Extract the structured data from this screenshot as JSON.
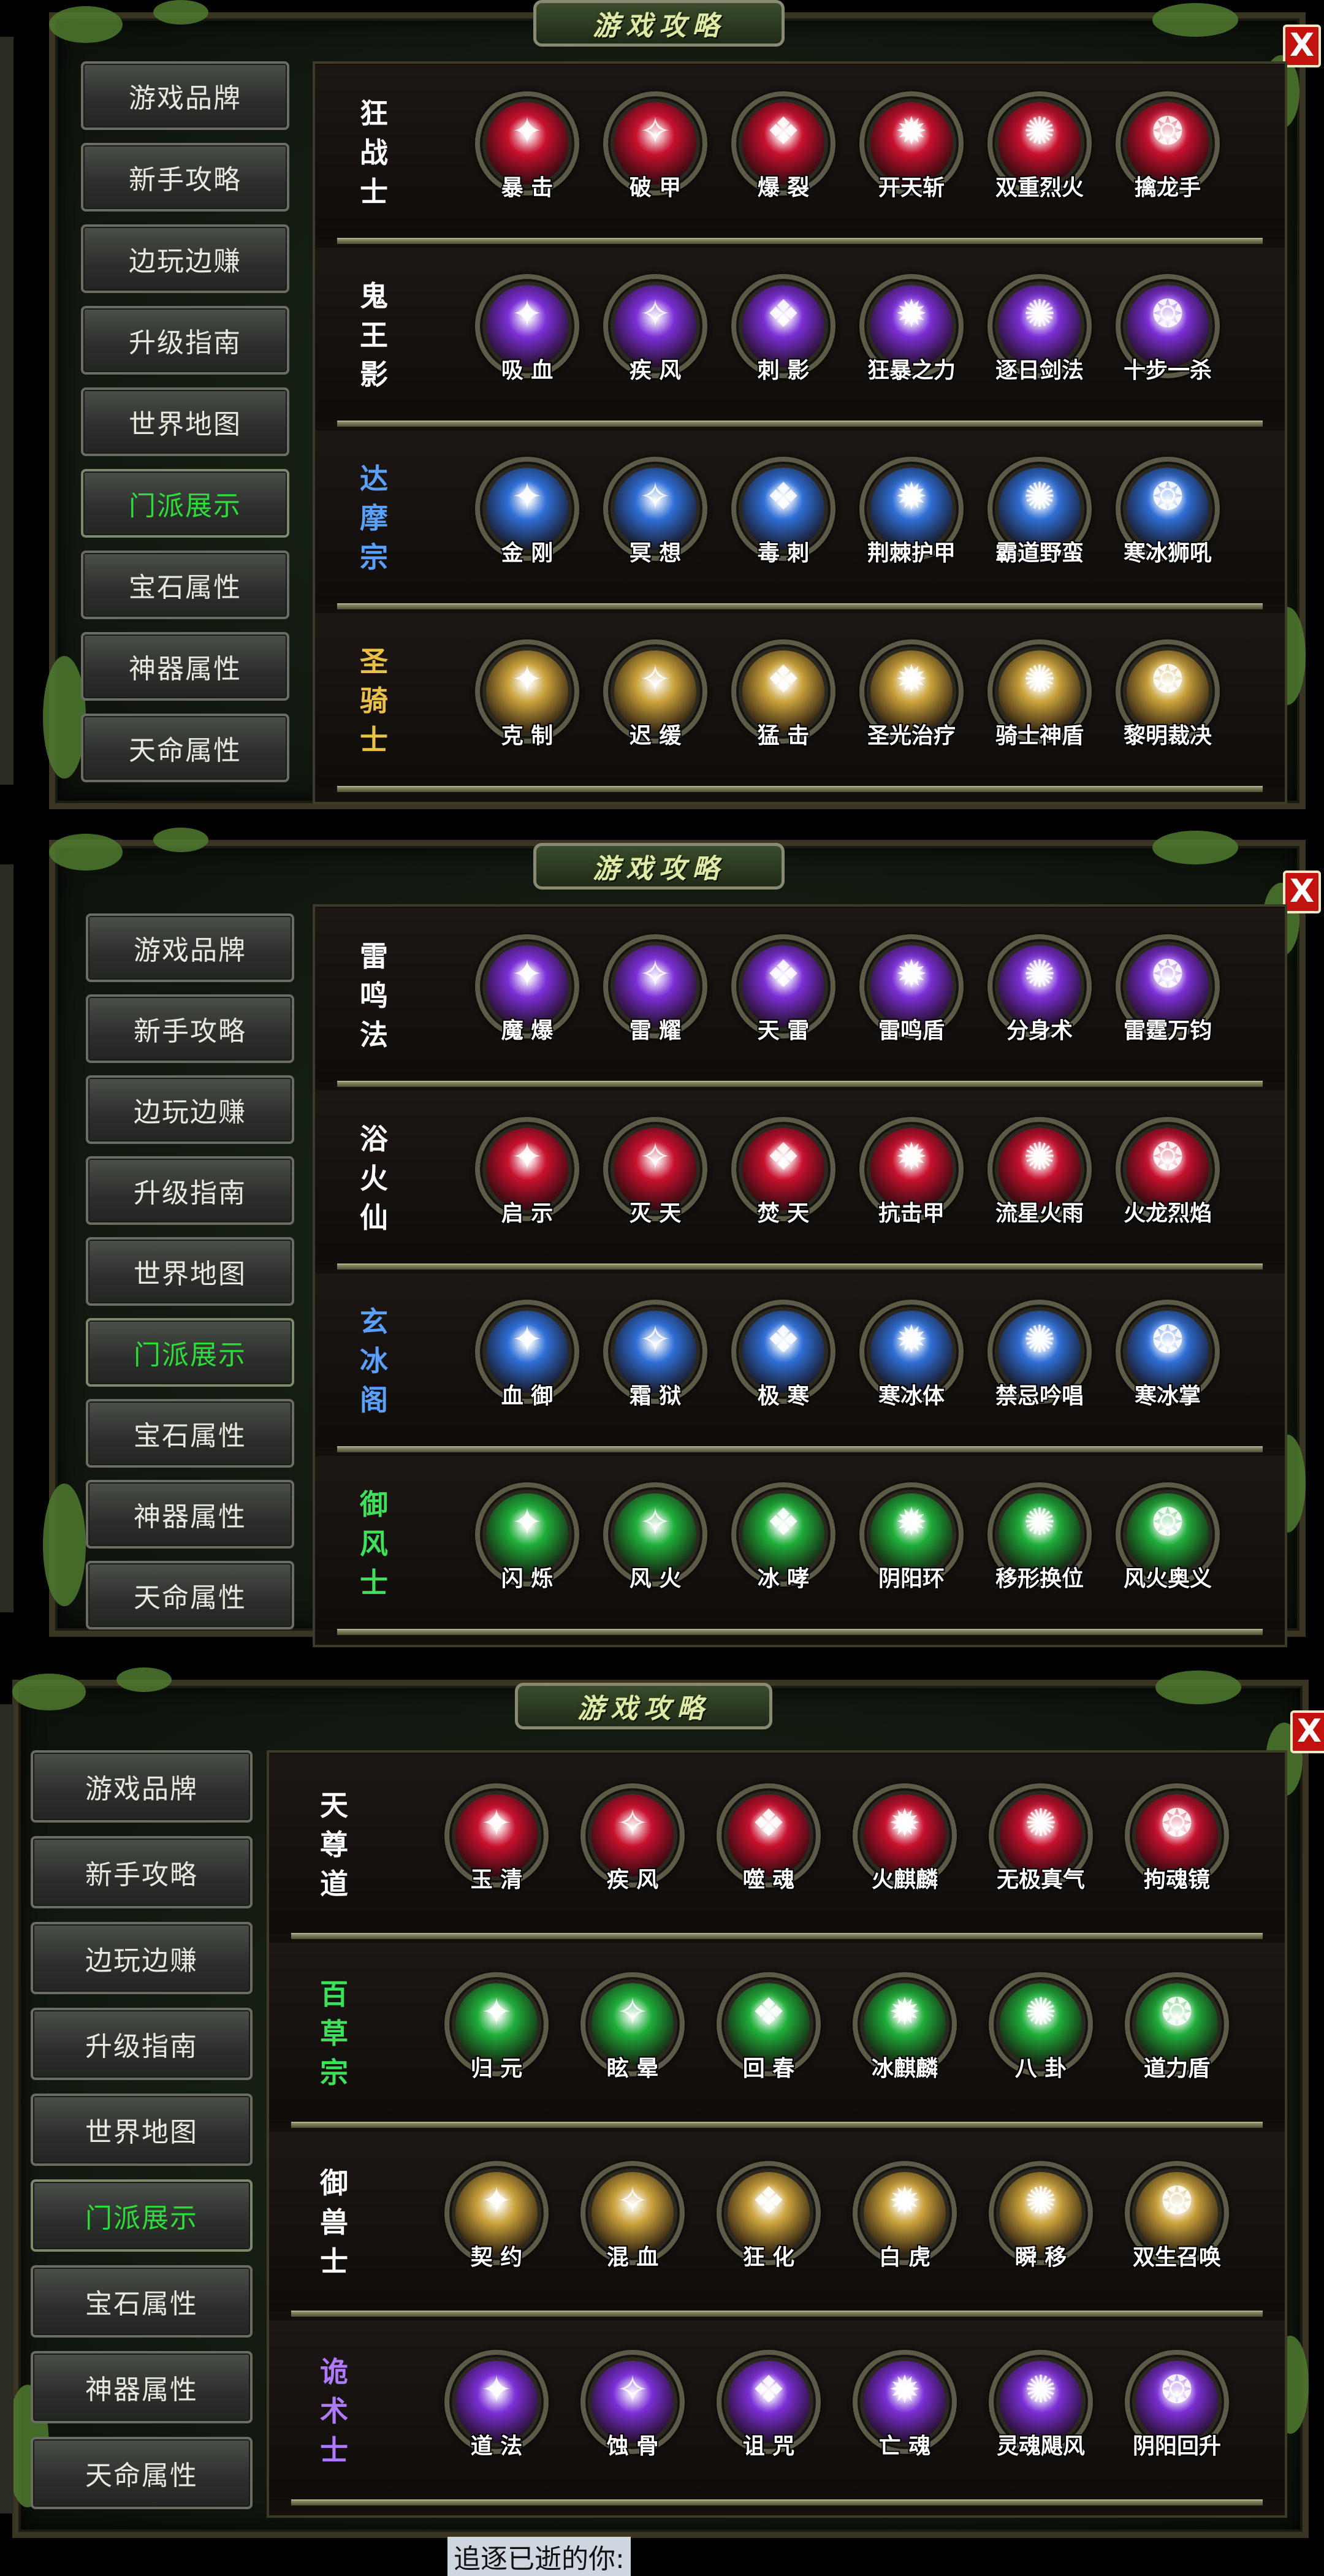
{
  "title": "游戏攻略",
  "close_label": "X",
  "nav_items": [
    "游戏品牌",
    "新手攻略",
    "边玩边赚",
    "升级指南",
    "世界地图",
    "门派展示",
    "宝石属性",
    "神器属性",
    "天命属性"
  ],
  "active_nav_index": 5,
  "panels": [
    {
      "factions": [
        {
          "name_chars": [
            "狂",
            "战",
            "士"
          ],
          "color": "#ffffff",
          "skills": [
            {
              "name": "暴 击"
            },
            {
              "name": "破 甲"
            },
            {
              "name": "爆 裂"
            },
            {
              "name": "开天斩"
            },
            {
              "name": "双重烈火"
            },
            {
              "name": "擒龙手"
            }
          ],
          "orb_color": "#c8102e"
        },
        {
          "name_chars": [
            "鬼",
            "王",
            "影"
          ],
          "color": "#ffffff",
          "skills": [
            {
              "name": "吸 血"
            },
            {
              "name": "疾 风"
            },
            {
              "name": "刺 影"
            },
            {
              "name": "狂暴之力"
            },
            {
              "name": "逐日剑法"
            },
            {
              "name": "十步一杀"
            }
          ],
          "orb_color": "#7b2fd6"
        },
        {
          "name_chars": [
            "达",
            "摩",
            "宗"
          ],
          "color": "#5aa0ff",
          "skills": [
            {
              "name": "金 刚"
            },
            {
              "name": "冥 想"
            },
            {
              "name": "毒 刺"
            },
            {
              "name": "荆棘护甲"
            },
            {
              "name": "霸道野蛮"
            },
            {
              "name": "寒冰狮吼"
            }
          ],
          "orb_color": "#2f6fd6"
        },
        {
          "name_chars": [
            "圣",
            "骑",
            "士"
          ],
          "color": "#e8c04a",
          "skills": [
            {
              "name": "克 制"
            },
            {
              "name": "迟 缓"
            },
            {
              "name": "猛 击"
            },
            {
              "name": "圣光治疗"
            },
            {
              "name": "骑士神盾"
            },
            {
              "name": "黎明裁决"
            }
          ],
          "orb_color": "#c9a13a"
        }
      ]
    },
    {
      "factions": [
        {
          "name_chars": [
            "雷",
            "鸣",
            "法"
          ],
          "color": "#ffffff",
          "skills": [
            {
              "name": "魔 爆"
            },
            {
              "name": "雷 耀"
            },
            {
              "name": "天 雷"
            },
            {
              "name": "雷鸣盾"
            },
            {
              "name": "分身术"
            },
            {
              "name": "雷霆万钧"
            }
          ],
          "orb_color": "#7b2fd6"
        },
        {
          "name_chars": [
            "浴",
            "火",
            "仙"
          ],
          "color": "#ffffff",
          "skills": [
            {
              "name": "启 示"
            },
            {
              "name": "灭 天"
            },
            {
              "name": "焚 天"
            },
            {
              "name": "抗击甲"
            },
            {
              "name": "流星火雨"
            },
            {
              "name": "火龙烈焰"
            }
          ],
          "orb_color": "#c8102e"
        },
        {
          "name_chars": [
            "玄",
            "冰",
            "阁"
          ],
          "color": "#5aa0ff",
          "skills": [
            {
              "name": "血 御"
            },
            {
              "name": "霜 狱"
            },
            {
              "name": "极 寒"
            },
            {
              "name": "寒冰体"
            },
            {
              "name": "禁忌吟唱"
            },
            {
              "name": "寒冰掌"
            }
          ],
          "orb_color": "#2f6fd6"
        },
        {
          "name_chars": [
            "御",
            "风",
            "士"
          ],
          "color": "#3fe05a",
          "skills": [
            {
              "name": "闪 烁"
            },
            {
              "name": "风 火"
            },
            {
              "name": "冰 哮"
            },
            {
              "name": "阴阳环"
            },
            {
              "name": "移形换位"
            },
            {
              "name": "风火奥义"
            }
          ],
          "orb_color": "#1fae3a"
        }
      ]
    },
    {
      "factions": [
        {
          "name_chars": [
            "天",
            "尊",
            "道"
          ],
          "color": "#ffffff",
          "skills": [
            {
              "name": "玉 清"
            },
            {
              "name": "疾 风"
            },
            {
              "name": "噬 魂"
            },
            {
              "name": "火麒麟"
            },
            {
              "name": "无极真气"
            },
            {
              "name": "拘魂镜"
            }
          ],
          "orb_color": "#c8102e"
        },
        {
          "name_chars": [
            "百",
            "草",
            "宗"
          ],
          "color": "#3fe05a",
          "skills": [
            {
              "name": "归 元"
            },
            {
              "name": "眩 晕"
            },
            {
              "name": "回 春"
            },
            {
              "name": "冰麒麟"
            },
            {
              "name": "八 卦"
            },
            {
              "name": "道力盾"
            }
          ],
          "orb_color": "#1fae3a"
        },
        {
          "name_chars": [
            "御",
            "兽",
            "士"
          ],
          "color": "#ffffff",
          "skills": [
            {
              "name": "契 约"
            },
            {
              "name": "混 血"
            },
            {
              "name": "狂 化"
            },
            {
              "name": "白 虎"
            },
            {
              "name": "瞬 移"
            },
            {
              "name": "双生召唤"
            }
          ],
          "orb_color": "#c9a13a"
        },
        {
          "name_chars": [
            "诡",
            "术",
            "士"
          ],
          "color": "#b07aff",
          "skills": [
            {
              "name": "道 法"
            },
            {
              "name": "蚀 骨"
            },
            {
              "name": "诅 咒"
            },
            {
              "name": "亡 魂"
            },
            {
              "name": "灵魂飓风"
            },
            {
              "name": "阴阳回升"
            }
          ],
          "orb_color": "#7b2fd6"
        }
      ]
    }
  ],
  "footer_text": "追逐已逝的你:"
}
